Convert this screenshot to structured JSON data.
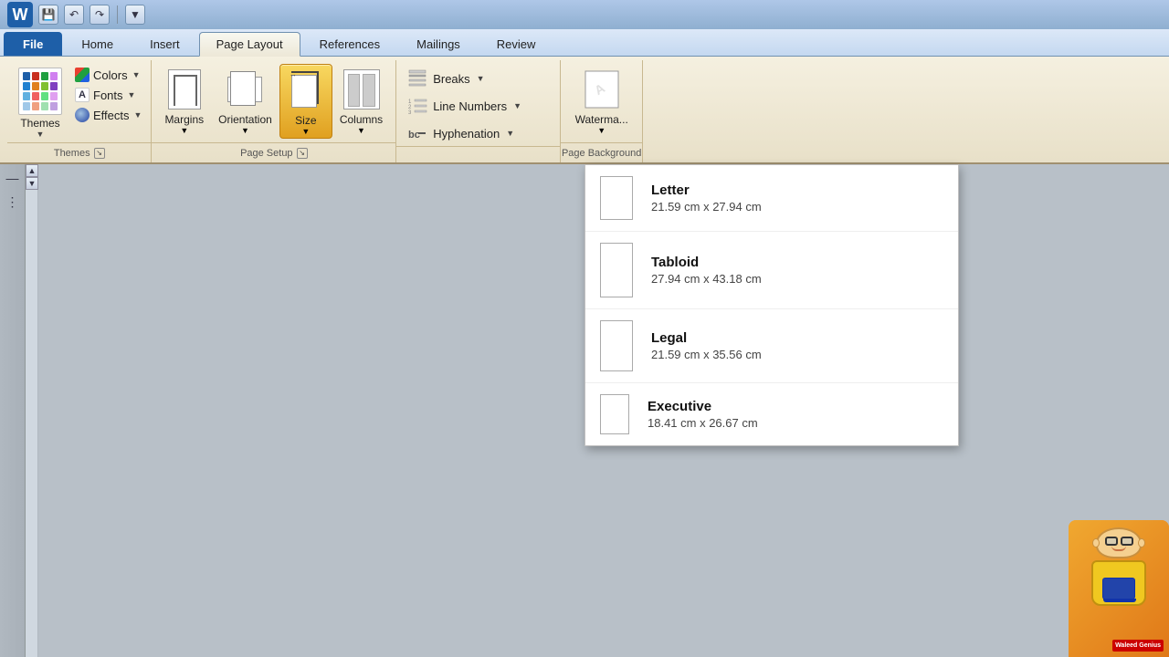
{
  "titlebar": {
    "icon": "W",
    "buttons": [
      "undo",
      "redo",
      "quickaccess"
    ]
  },
  "tabs": [
    {
      "label": "File",
      "id": "file",
      "type": "file"
    },
    {
      "label": "Home",
      "id": "home"
    },
    {
      "label": "Insert",
      "id": "insert"
    },
    {
      "label": "Page Layout",
      "id": "pagelayout",
      "active": true
    },
    {
      "label": "References",
      "id": "references"
    },
    {
      "label": "Mailings",
      "id": "mailings"
    },
    {
      "label": "Review",
      "id": "review"
    }
  ],
  "ribbon": {
    "groups": [
      {
        "id": "themes",
        "label": "Themes",
        "big_button_label": "Themes",
        "side_buttons": [
          {
            "label": "Colors",
            "dropdown": true
          },
          {
            "label": "Fonts",
            "dropdown": true
          },
          {
            "label": "Effects",
            "dropdown": true
          }
        ]
      },
      {
        "id": "page-setup",
        "label": "Page Setup",
        "buttons": [
          {
            "label": "Margins",
            "id": "margins"
          },
          {
            "label": "Orientation",
            "id": "orientation"
          },
          {
            "label": "Size",
            "id": "size",
            "active": true
          },
          {
            "label": "Columns",
            "id": "columns"
          }
        ]
      },
      {
        "id": "page-background",
        "label": "Page Background",
        "buttons": [
          {
            "label": "Watermark",
            "id": "watermark"
          }
        ]
      },
      {
        "id": "page-setup-right",
        "label": "",
        "buttons": [
          {
            "label": "Breaks",
            "dropdown": true
          },
          {
            "label": "Line Numbers",
            "dropdown": true
          },
          {
            "label": "Hyphenation",
            "dropdown": true
          }
        ]
      }
    ]
  },
  "size_dropdown": {
    "items": [
      {
        "name": "Letter",
        "dims": "21.59 cm x 27.94 cm"
      },
      {
        "name": "Tabloid",
        "dims": "27.94 cm x 43.18 cm"
      },
      {
        "name": "Legal",
        "dims": "21.59 cm x 35.56 cm"
      },
      {
        "name": "Executive",
        "dims": "18.41 cm x 26.67 cm"
      }
    ]
  },
  "mascot": {
    "badge": "Waleed Genius"
  }
}
